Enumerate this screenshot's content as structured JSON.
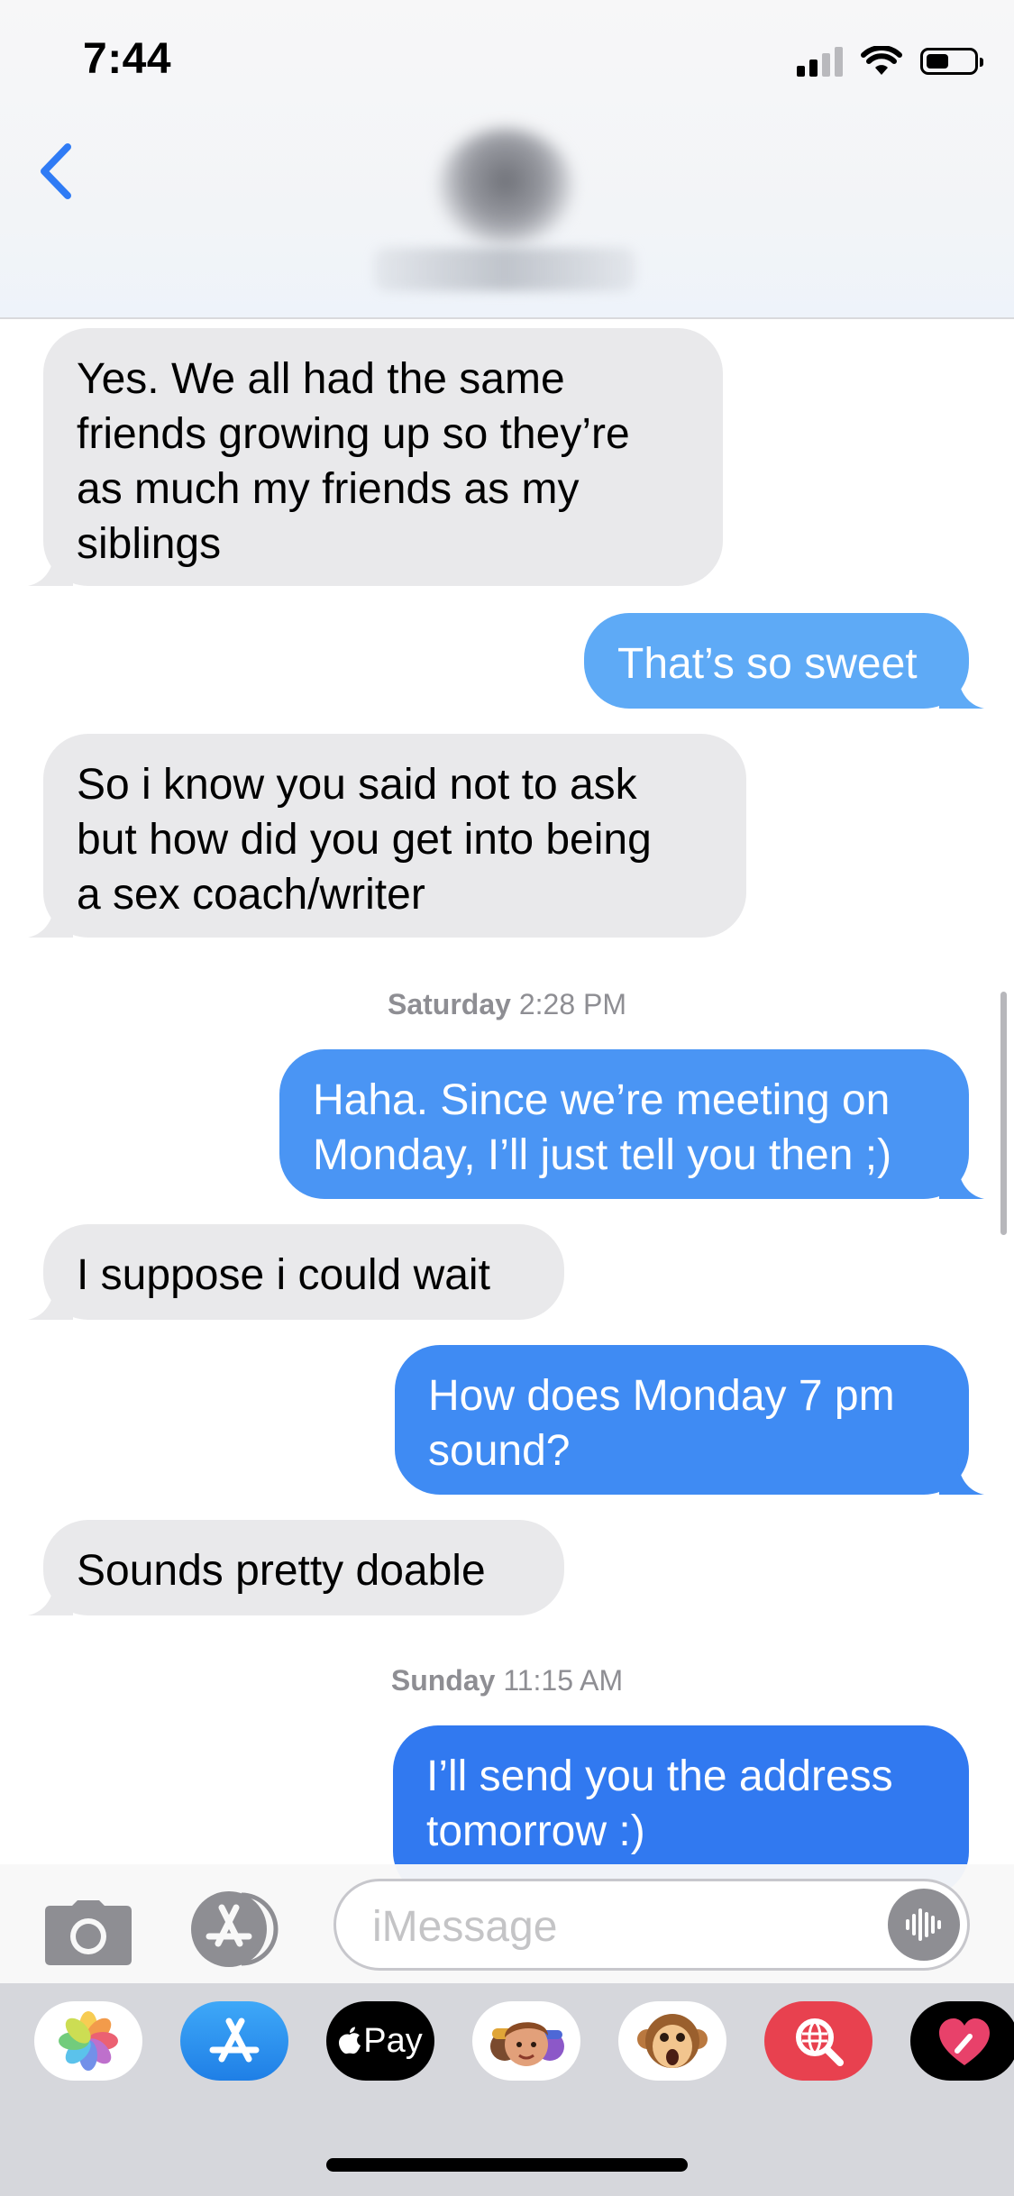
{
  "status_bar": {
    "time": "7:44"
  },
  "header": {
    "back_icon": "chevron-left-icon"
  },
  "colors": {
    "received_bubble": "#e9e9eb",
    "sent_bubble_light": "#5eaaf6",
    "sent_bubble": "#3d86f1",
    "accent": "#2f7bf5",
    "timestamp": "#8e8e93"
  },
  "conversation": {
    "messages": [
      {
        "direction": "received",
        "text": "Yes. We all had the same\nfriends growing up so they’re\nas much my friends as my\nsiblings"
      },
      {
        "direction": "sent",
        "text": "That’s so sweet"
      },
      {
        "direction": "received",
        "text": "So i know you said not to ask\nbut how did you get into being\na sex coach/writer"
      },
      {
        "direction": "sent",
        "text": "Haha. Since we’re meeting on\nMonday, I’ll just tell you then ;)"
      },
      {
        "direction": "received",
        "text": "I suppose i could wait"
      },
      {
        "direction": "sent",
        "text": "How does Monday 7 pm\nsound?"
      },
      {
        "direction": "received",
        "text": "Sounds pretty doable"
      },
      {
        "direction": "sent",
        "text": "I’ll send you the address\ntomorrow :)"
      }
    ],
    "timestamps": [
      {
        "day": "Saturday",
        "time": "2:28 PM"
      },
      {
        "day": "Sunday",
        "time": "11:15 AM"
      }
    ]
  },
  "compose": {
    "placeholder": "iMessage",
    "camera_icon": "camera-icon",
    "apps_icon": "app-store-icon",
    "audio_icon": "audio-waveform-icon"
  },
  "app_drawer": {
    "apps": [
      {
        "name": "Photos",
        "icon": "photos-icon"
      },
      {
        "name": "App Store",
        "icon": "app-store-icon"
      },
      {
        "name": "Apple Pay",
        "icon": "apple-pay-icon",
        "label": "Pay"
      },
      {
        "name": "Memoji",
        "icon": "memoji-icon"
      },
      {
        "name": "Animoji",
        "icon": "monkey-icon"
      },
      {
        "name": "Images",
        "icon": "image-search-icon"
      },
      {
        "name": "Digital Touch",
        "icon": "heart-icon"
      }
    ]
  }
}
